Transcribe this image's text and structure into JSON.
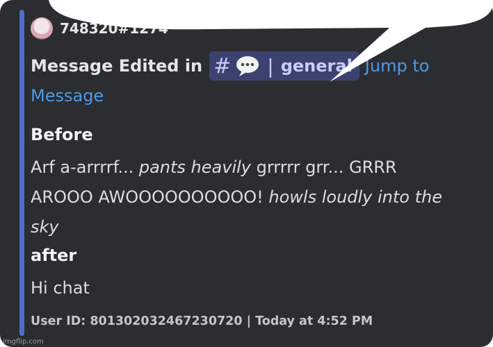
{
  "author": {
    "name": "748320#1274",
    "avatar_icon": "anime-avatar-icon"
  },
  "embed": {
    "title": "Message Edited in",
    "channel": {
      "hash": "#",
      "icon": "speech-bubble-icon",
      "separator": "|",
      "name": "general"
    },
    "jump_link_part1": "Jump to",
    "jump_link_part2": "Message"
  },
  "before": {
    "label": "Before",
    "parts": [
      "Arf a-arrrrf... ",
      "pants heavily",
      " grrrrr grr... GRRR AROOO AWOOOOOOOOOO! ",
      "howls loudly into the sky"
    ]
  },
  "after": {
    "label": "after",
    "value": "Hi chat"
  },
  "footer": {
    "text": "User ID: 801302032467230720 | Today at 4:52 PM"
  },
  "watermark": "imgflip.com",
  "colors": {
    "accent": "#4e6ec9",
    "link": "#4f98e6",
    "background": "#2b2d31",
    "channel_pill": "#3c4270"
  }
}
